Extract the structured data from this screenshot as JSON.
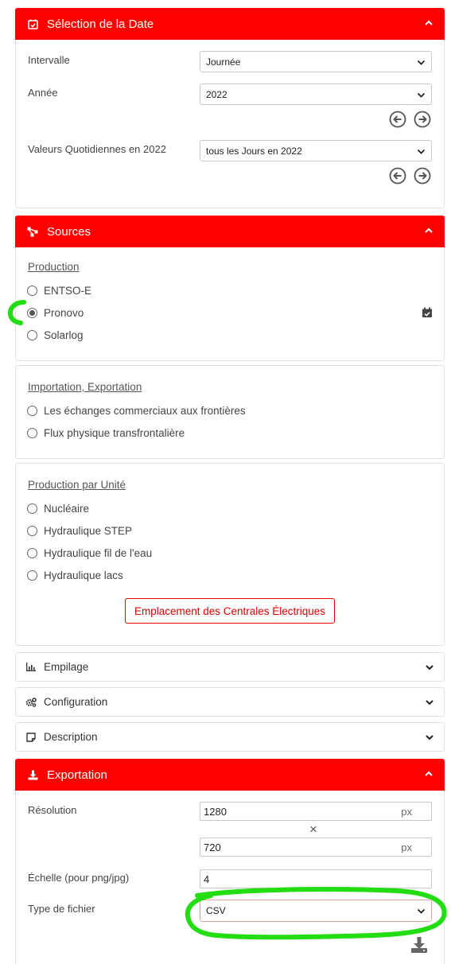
{
  "date_section": {
    "title": "Sélection de la Date",
    "interval_label": "Intervalle",
    "interval_value": "Journée",
    "year_label": "Année",
    "year_value": "2022",
    "daily_label": "Valeurs Quotidiennes en 2022",
    "daily_value": "tous les Jours en 2022"
  },
  "sources_section": {
    "title": "Sources",
    "production": {
      "heading": "Production",
      "options": [
        "ENTSO-E",
        "Pronovo",
        "Solarlog"
      ],
      "selected": "Pronovo"
    },
    "import_export": {
      "heading": "Importation, Exportation",
      "options": [
        "Les échanges commerciaux aux frontières",
        "Flux physique transfrontalière"
      ]
    },
    "production_unit": {
      "heading": "Production par Unité",
      "options": [
        "Nucléaire",
        "Hydraulique STEP",
        "Hydraulique fil de l'eau",
        "Hydraulique lacs"
      ],
      "button_label": "Emplacement des Centrales Électriques"
    }
  },
  "collapsed_sections": {
    "stacking": "Empilage",
    "configuration": "Configuration",
    "description": "Description"
  },
  "export_section": {
    "title": "Exportation",
    "resolution_label": "Résolution",
    "width_value": "1280",
    "height_value": "720",
    "unit": "px",
    "times_symbol": "×",
    "scale_label": "Échelle (pour png/jpg)",
    "scale_value": "4",
    "filetype_label": "Type de fichier",
    "filetype_value": "CSV"
  },
  "colors": {
    "accent_red": "#ff0000",
    "annotation_green": "#22dd11"
  }
}
